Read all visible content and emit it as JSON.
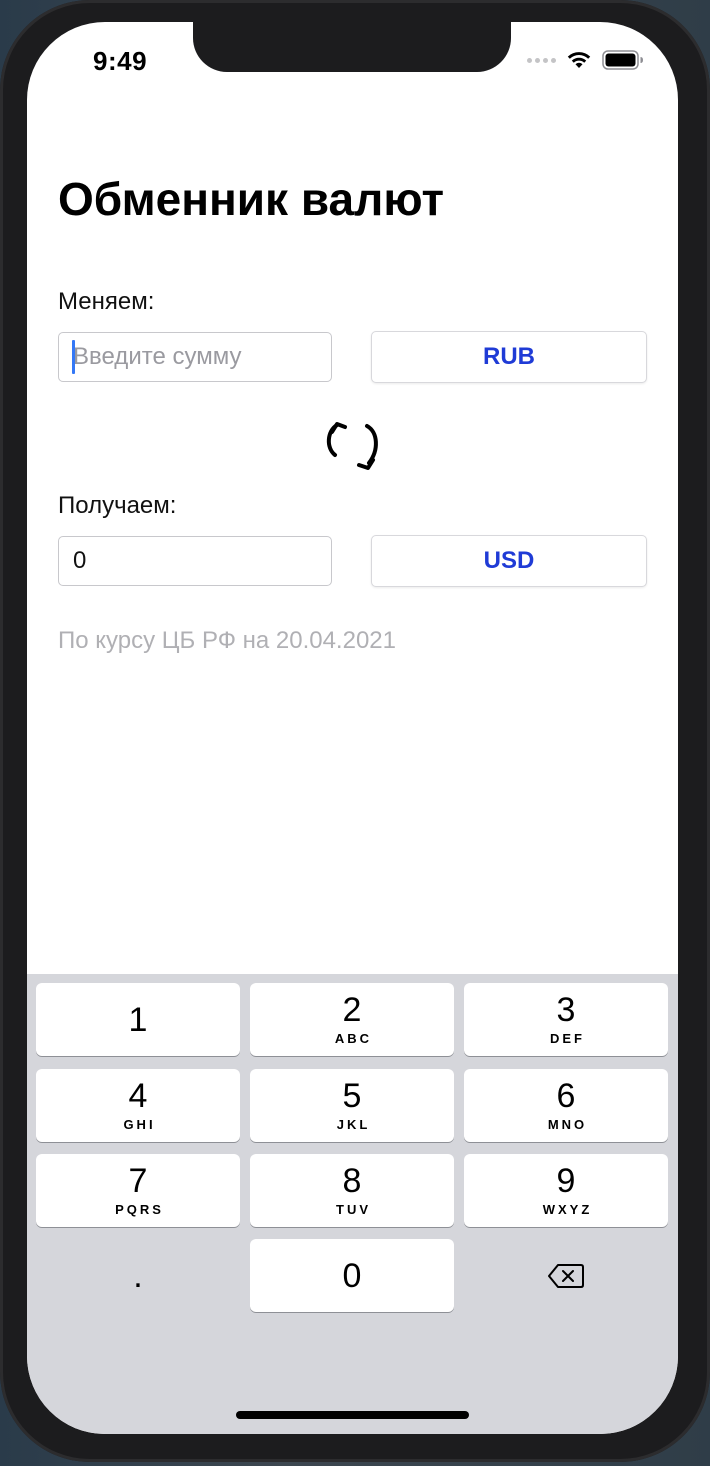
{
  "status_bar": {
    "time": "9:49"
  },
  "app": {
    "title": "Обменник валют",
    "from_label": "Меняем:",
    "from_amount": {
      "value": "",
      "placeholder": "Введите сумму"
    },
    "from_currency": "RUB",
    "to_label": "Получаем:",
    "to_amount": {
      "value": "0"
    },
    "to_currency": "USD",
    "rate_note": "По курсу ЦБ РФ на 20.04.2021"
  },
  "keyboard": {
    "keys": [
      {
        "digit": "1",
        "letters": ""
      },
      {
        "digit": "2",
        "letters": "ABC"
      },
      {
        "digit": "3",
        "letters": "DEF"
      },
      {
        "digit": "4",
        "letters": "GHI"
      },
      {
        "digit": "5",
        "letters": "JKL"
      },
      {
        "digit": "6",
        "letters": "MNO"
      },
      {
        "digit": "7",
        "letters": "PQRS"
      },
      {
        "digit": "8",
        "letters": "TUV"
      },
      {
        "digit": "9",
        "letters": "WXYZ"
      },
      {
        "digit": ".",
        "letters": ""
      },
      {
        "digit": "0",
        "letters": ""
      }
    ],
    "delete_icon": "backspace-icon"
  },
  "icons": {
    "swap": "swap-arrows-icon",
    "wifi": "wifi-icon",
    "battery": "battery-icon",
    "signal": "cellular-signal-icon"
  },
  "colors": {
    "accent": "#1f3bd6",
    "caret": "#3478f6",
    "muted_text": "#b0b0b4",
    "keyboard_bg": "#d5d6db"
  }
}
